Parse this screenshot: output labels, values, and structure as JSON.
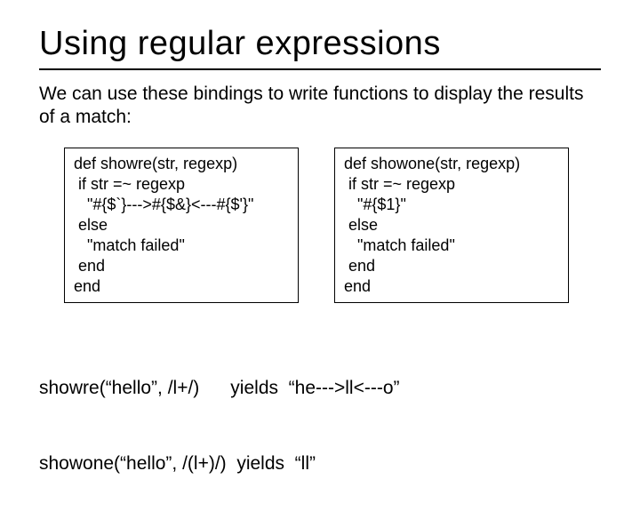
{
  "title": "Using regular expressions",
  "intro": "We can use these bindings to write functions to display the results of a match:",
  "code_left": "def showre(str, regexp)\n if str =~ regexp\n   \"#{$`}--->#{$&}<---#{$'}\"\n else\n   \"match failed\"\n end\nend",
  "code_right": "def showone(str, regexp)\n if str =~ regexp\n   \"#{$1}\"\n else\n   \"match failed\"\n end\nend",
  "example1": "showre(“hello”, /l+/)      yields  “he--->ll<---o”",
  "example2": "showone(“hello”, /(l+)/)  yields  “ll”"
}
